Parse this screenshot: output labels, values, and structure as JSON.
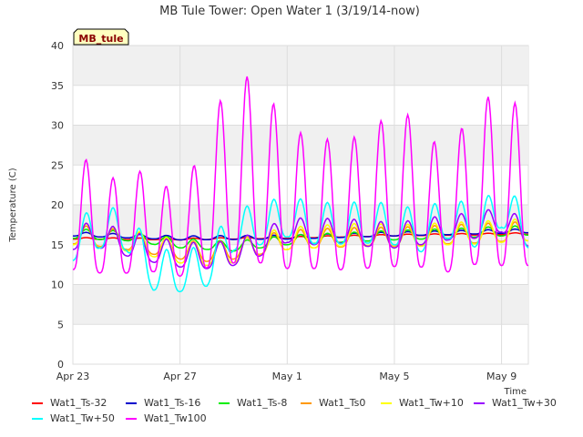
{
  "chart_data": {
    "type": "line",
    "title": "MB Tule Tower: Open Water 1 (3/19/14-now)",
    "badge": "MB_tule",
    "ylabel": "Temperature (C)",
    "xlabel": "Time",
    "ylim": [
      0,
      40
    ],
    "yticks": [
      0,
      5,
      10,
      15,
      20,
      25,
      30,
      35,
      40
    ],
    "xlim": [
      "2014-04-23",
      "2014-05-10"
    ],
    "xticks": [
      {
        "date": "2014-04-23",
        "label": "Apr 23"
      },
      {
        "date": "2014-04-27",
        "label": "Apr 27"
      },
      {
        "date": "2014-05-01",
        "label": "May 1"
      },
      {
        "date": "2014-05-05",
        "label": "May 5"
      },
      {
        "date": "2014-05-09",
        "label": "May 9"
      }
    ],
    "grid": true,
    "legend_position": "bottom",
    "series": [
      {
        "name": "Wat1_Ts-32",
        "color": "#ff0000",
        "x": [
          "2014-04-23",
          "2014-04-27",
          "2014-05-01",
          "2014-05-05",
          "2014-05-10"
        ],
        "y": [
          15.9,
          15.8,
          16.0,
          16.3,
          16.5
        ]
      },
      {
        "name": "Wat1_Ts-16",
        "color": "#0000cc",
        "x": [
          "2014-04-23",
          "2014-04-27",
          "2014-05-01",
          "2014-05-05",
          "2014-05-10"
        ],
        "y": [
          16.6,
          16.1,
          16.2,
          16.6,
          17.0
        ]
      },
      {
        "name": "Wat1_Ts-8",
        "color": "#00ee00",
        "x": [
          "2014-04-23",
          "2014-04-25",
          "2014-04-27",
          "2014-04-29",
          "2014-05-01",
          "2014-05-03",
          "2014-05-05",
          "2014-05-07",
          "2014-05-09",
          "2014-05-10"
        ],
        "y": [
          17.0,
          16.7,
          15.8,
          15.4,
          16.2,
          16.5,
          16.8,
          17.0,
          17.3,
          17.4
        ]
      },
      {
        "name": "Wat1_Ts0",
        "color": "#ff9900",
        "x": [
          "2014-04-23",
          "2014-04-24",
          "2014-04-25",
          "2014-04-26",
          "2014-04-27",
          "2014-04-28",
          "2014-04-29",
          "2014-04-30",
          "2014-05-01",
          "2014-05-02",
          "2014-05-03",
          "2014-05-04",
          "2014-05-05",
          "2014-05-06",
          "2014-05-07",
          "2014-05-08",
          "2014-05-09",
          "2014-05-10"
        ],
        "y": [
          17.5,
          17.2,
          16.8,
          16.2,
          15.6,
          15.3,
          15.6,
          16.2,
          16.8,
          17.0,
          17.1,
          17.2,
          17.2,
          17.3,
          17.5,
          17.6,
          17.8,
          17.9
        ]
      },
      {
        "name": "Wat1_Tw+10",
        "color": "#ffff00",
        "x": [
          "2014-04-23",
          "2014-04-24",
          "2014-04-25",
          "2014-04-26",
          "2014-04-27",
          "2014-04-28",
          "2014-04-29",
          "2014-04-30",
          "2014-05-01",
          "2014-05-02",
          "2014-05-03",
          "2014-05-04",
          "2014-05-05",
          "2014-05-06",
          "2014-05-07",
          "2014-05-08",
          "2014-05-09",
          "2014-05-10"
        ],
        "y": [
          17.8,
          17.5,
          17.0,
          16.3,
          15.5,
          15.2,
          15.5,
          16.5,
          17.2,
          17.4,
          17.6,
          17.7,
          17.5,
          17.6,
          17.8,
          17.9,
          18.1,
          18.3
        ]
      },
      {
        "name": "Wat1_Tw+30",
        "color": "#9900ff",
        "x": [
          "2014-04-23",
          "2014-04-24",
          "2014-04-25",
          "2014-04-26",
          "2014-04-27",
          "2014-04-28",
          "2014-04-29",
          "2014-04-30",
          "2014-05-01",
          "2014-05-02",
          "2014-05-03",
          "2014-05-04",
          "2014-05-05",
          "2014-05-06",
          "2014-05-07",
          "2014-05-08",
          "2014-05-09",
          "2014-05-10"
        ],
        "y": [
          17.6,
          17.8,
          16.8,
          16.0,
          15.4,
          15.2,
          15.6,
          16.8,
          18.5,
          18.2,
          18.4,
          18.0,
          17.8,
          18.2,
          18.8,
          19.0,
          19.8,
          18.0
        ]
      },
      {
        "name": "Wat1_Tw+50",
        "color": "#00ffff",
        "x": [
          "2014-04-23",
          "2014-04-24",
          "2014-04-25",
          "2014-04-26",
          "2014-04-27",
          "2014-04-28",
          "2014-04-29",
          "2014-04-30",
          "2014-05-01",
          "2014-05-02",
          "2014-05-03",
          "2014-05-04",
          "2014-05-05",
          "2014-05-06",
          "2014-05-07",
          "2014-05-08",
          "2014-05-09",
          "2014-05-10"
        ],
        "y": [
          18.2,
          19.8,
          19.5,
          14.5,
          14.3,
          15.0,
          19.5,
          20.2,
          21.2,
          20.3,
          20.3,
          20.4,
          20.2,
          19.3,
          21.0,
          19.9,
          22.4,
          19.8
        ]
      },
      {
        "name": "Wat1_Tw100",
        "color": "#ff00ff",
        "x": [
          "2014-04-23",
          "2014-04-24",
          "2014-04-25",
          "2014-04-26",
          "2014-04-27",
          "2014-04-28",
          "2014-04-29",
          "2014-04-30",
          "2014-05-01",
          "2014-05-02",
          "2014-05-03",
          "2014-05-04",
          "2014-05-05",
          "2014-05-06",
          "2014-05-07",
          "2014-05-08",
          "2014-05-09",
          "2014-05-10"
        ],
        "y": [
          27.8,
          23.5,
          23.3,
          25.1,
          19.5,
          30.1,
          36.0,
          36.2,
          29.1,
          29.0,
          27.5,
          29.5,
          31.6,
          31.0,
          24.8,
          34.3,
          32.8,
          32.8
        ]
      }
    ]
  }
}
